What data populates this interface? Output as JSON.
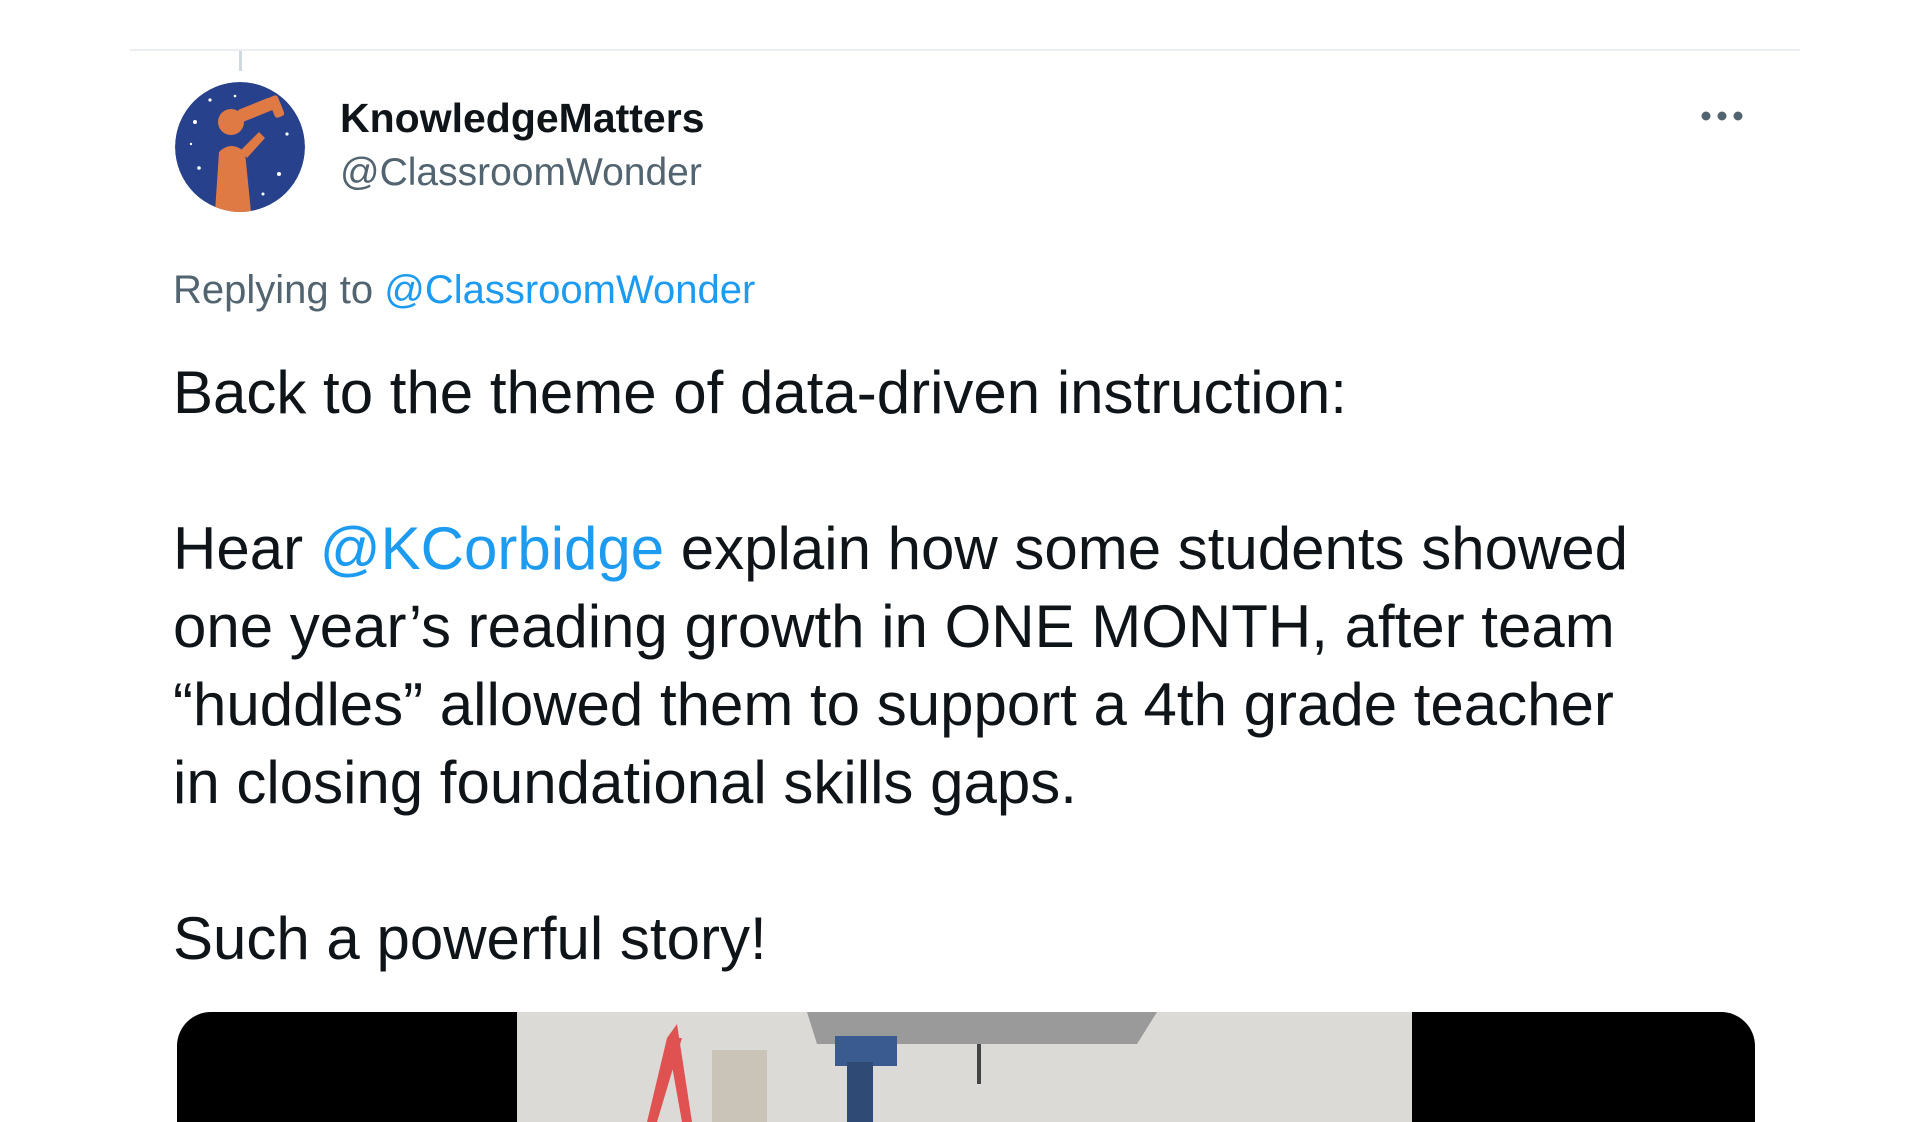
{
  "tweet": {
    "author": {
      "display_name": "KnowledgeMatters",
      "handle": "@ClassroomWonder",
      "avatar_icon": "telescope-child-avatar-icon"
    },
    "more_icon": "ellipsis-icon",
    "reply": {
      "prefix": "Replying to ",
      "to": "@ClassroomWonder"
    },
    "paragraphs": {
      "p1": "Back to the theme of data-driven instruction:",
      "p2_intro": "Hear ",
      "p2_mention": "@KCorbidge",
      "p2_line1_rest": " explain how some students showed",
      "p2_line2": "one year’s reading growth in ONE MONTH, after team",
      "p2_line3": "“huddles” allowed them to support a 4th grade teacher",
      "p2_line4": "in closing foundational skills gaps.",
      "p3": "Such a powerful story!"
    },
    "media": {
      "kind": "video-thumbnail"
    }
  },
  "colors": {
    "text": "#0f1419",
    "secondary": "#536471",
    "link": "#1d9bf0",
    "divider": "#eaeef1",
    "avatar_bg": "#27418d",
    "avatar_figure": "#e07a45"
  }
}
